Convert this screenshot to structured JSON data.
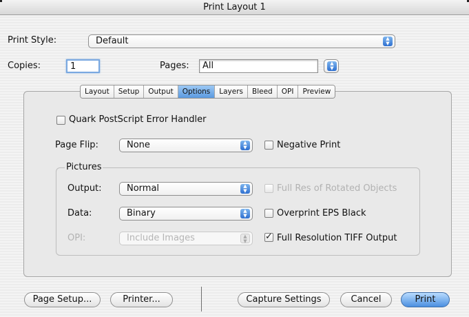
{
  "window": {
    "title": "Print Layout 1"
  },
  "print_style": {
    "label": "Print Style:",
    "value": "Default"
  },
  "copies": {
    "label": "Copies:",
    "value": "1"
  },
  "pages": {
    "label": "Pages:",
    "value": "All"
  },
  "tabs": [
    {
      "label": "Layout",
      "active": false
    },
    {
      "label": "Setup",
      "active": false
    },
    {
      "label": "Output",
      "active": false
    },
    {
      "label": "Options",
      "active": true
    },
    {
      "label": "Layers",
      "active": false
    },
    {
      "label": "Bleed",
      "active": false
    },
    {
      "label": "OPI",
      "active": false
    },
    {
      "label": "Preview",
      "active": false
    }
  ],
  "options": {
    "quark_ps_error_handler": {
      "label": "Quark PostScript Error Handler",
      "checked": false
    },
    "page_flip": {
      "label": "Page Flip:",
      "value": "None"
    },
    "negative_print": {
      "label": "Negative Print",
      "checked": false
    },
    "pictures": {
      "group_label": "Pictures",
      "output": {
        "label": "Output:",
        "value": "Normal"
      },
      "data": {
        "label": "Data:",
        "value": "Binary"
      },
      "opi": {
        "label": "OPI:",
        "value": "Include Images",
        "enabled": false
      },
      "full_res_rotated": {
        "label": "Full Res of Rotated Objects",
        "checked": false,
        "enabled": false
      },
      "overprint_eps_black": {
        "label": "Overprint EPS Black",
        "checked": false
      },
      "full_res_tiff": {
        "label": "Full Resolution TIFF Output",
        "checked": true
      }
    }
  },
  "buttons": {
    "page_setup": "Page Setup...",
    "printer": "Printer...",
    "capture_settings": "Capture Settings",
    "cancel": "Cancel",
    "print": "Print"
  },
  "colors": {
    "accent": "#5b9ae0",
    "window_bg": "#ececec"
  }
}
